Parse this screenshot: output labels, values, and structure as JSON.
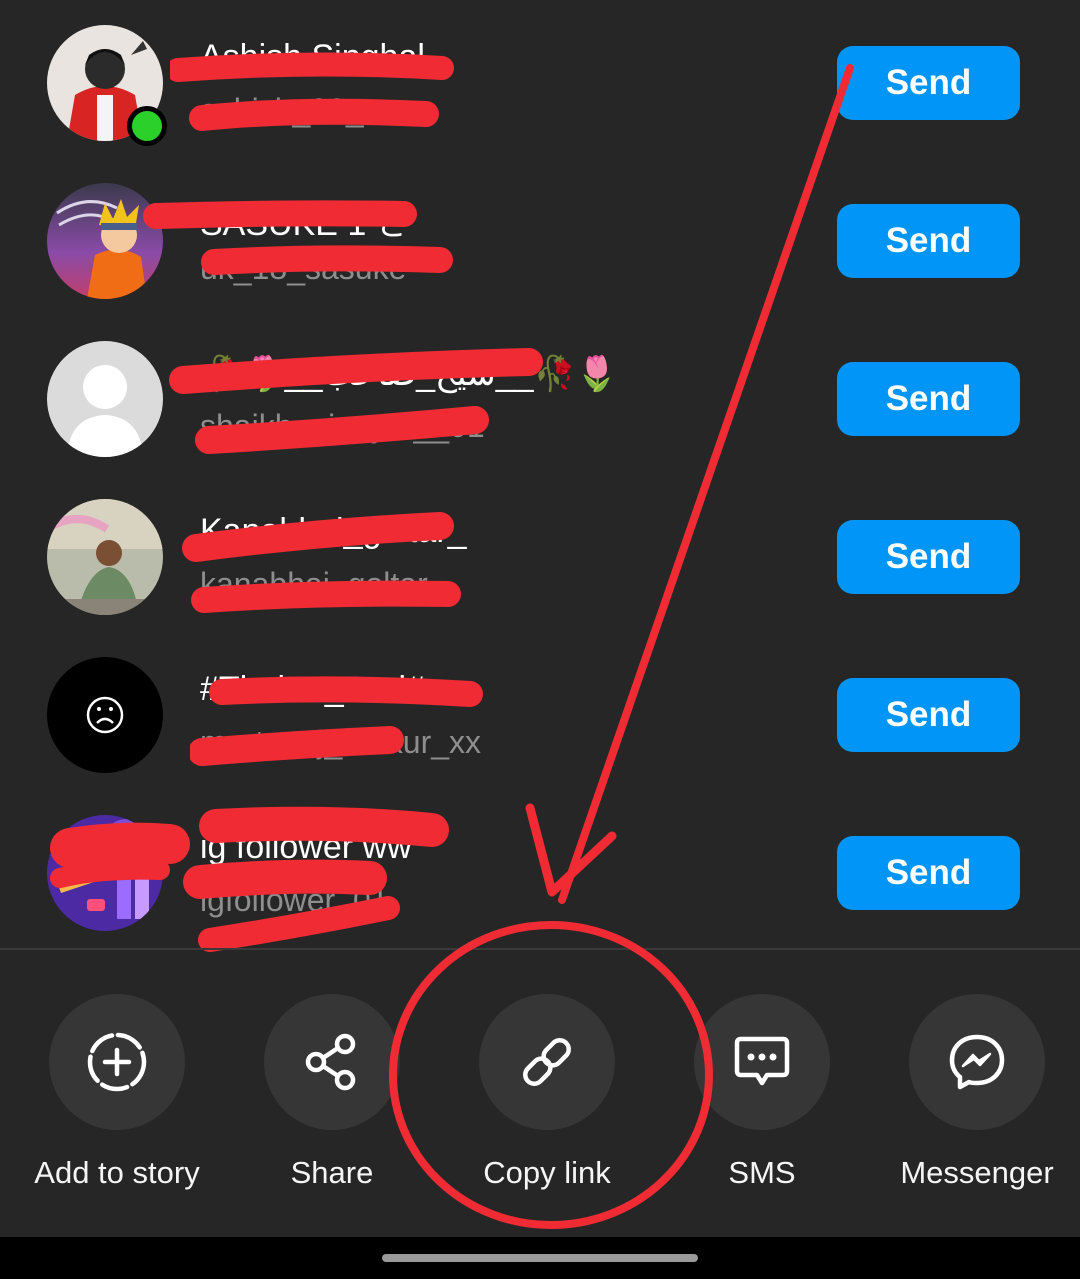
{
  "contacts": [
    {
      "name": "Ashish Singhal",
      "username": "ashish_99_xx",
      "send_label": "Send",
      "online": true,
      "avatar": "anime-boy-avatar"
    },
    {
      "name": "SASUKE 1 さ",
      "username": "uk_18_sasuke",
      "send_label": "Send",
      "online": false,
      "avatar": "naruto-avatar"
    },
    {
      "name": "🥀🌷__شيخ_صاحب__🥀🌷",
      "username": "shaikh__inayat__01",
      "send_label": "Send",
      "online": false,
      "avatar": "default-profile-avatar"
    },
    {
      "name": "Kanabhai_goltar_",
      "username": "kanabhai_goltar_",
      "send_label": "Send",
      "online": false,
      "avatar": "photo-avatar"
    },
    {
      "name": "#Thakur_Dad#",
      "username": "mr_tanuj_thakur_xx",
      "send_label": "Send",
      "online": false,
      "avatar": "sad-face-avatar"
    },
    {
      "name": "ig follower ww",
      "username": "igfollower_01",
      "send_label": "Send",
      "online": false,
      "avatar": "promo-avatar"
    }
  ],
  "actions": [
    {
      "label": "Add to story",
      "icon": "add-to-story-icon"
    },
    {
      "label": "Share",
      "icon": "share-icon"
    },
    {
      "label": "Copy link",
      "icon": "link-icon"
    },
    {
      "label": "SMS",
      "icon": "sms-icon"
    },
    {
      "label": "Messenger",
      "icon": "messenger-icon"
    }
  ],
  "colors": {
    "background": "#262626",
    "send_button": "#0095f6",
    "annotation_red": "#f02b34",
    "online_dot": "#2bd02b"
  }
}
